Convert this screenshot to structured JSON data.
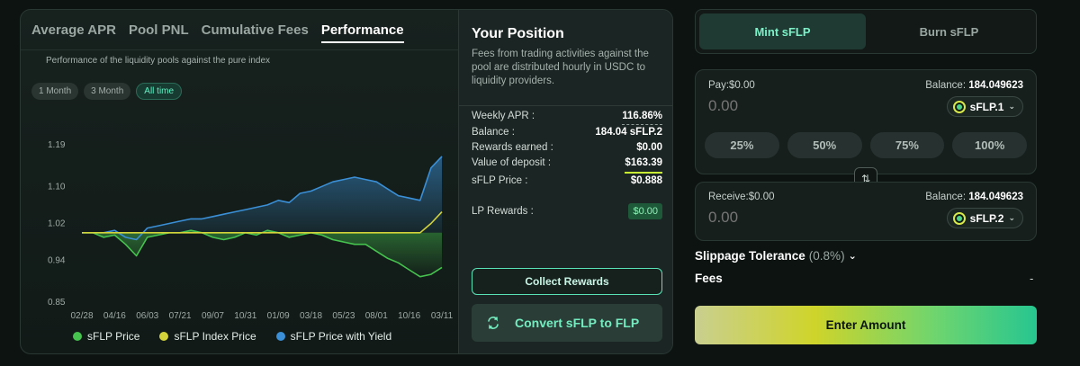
{
  "chart_tabs": [
    "Average APR",
    "Pool PNL",
    "Cumulative Fees",
    "Performance"
  ],
  "active_tab": "Performance",
  "subtitle": "Performance of the liquidity pools against the pure index",
  "range_buttons": [
    "1 Month",
    "3 Month",
    "All time"
  ],
  "active_range": "All time",
  "chart_data": {
    "type": "line",
    "y_ticks": [
      "1.19",
      "1.10",
      "1.02",
      "0.94",
      "0.85"
    ],
    "ylim": [
      0.85,
      1.19
    ],
    "x_ticks": [
      "02/28",
      "04/16",
      "06/03",
      "07/21",
      "09/07",
      "10/31",
      "01/09",
      "03/18",
      "05/23",
      "08/01",
      "10/16",
      "03/11"
    ],
    "grid": false,
    "legend_position": "bottom",
    "series": [
      {
        "name": "sFLP Price",
        "color": "#46c24e",
        "values": [
          1.0,
          1.0,
          0.99,
          0.995,
          0.975,
          0.95,
          0.99,
          0.995,
          1.0,
          1.0,
          1.005,
          1.0,
          0.99,
          0.985,
          0.99,
          1.0,
          0.995,
          1.005,
          1.0,
          0.99,
          0.995,
          1.0,
          0.995,
          0.985,
          0.98,
          0.975,
          0.975,
          0.96,
          0.945,
          0.935,
          0.92,
          0.905,
          0.91,
          0.925
        ]
      },
      {
        "name": "sFLP Index Price",
        "color": "#d4d43a",
        "values": [
          1.0,
          1.0,
          1.0,
          1.0,
          1.0,
          1.0,
          1.0,
          1.0,
          1.0,
          1.0,
          1.0,
          1.0,
          1.0,
          1.0,
          1.0,
          1.0,
          1.0,
          1.0,
          1.0,
          1.0,
          1.0,
          1.0,
          1.0,
          1.0,
          1.0,
          1.0,
          1.0,
          1.0,
          1.0,
          1.0,
          1.0,
          1.0,
          1.02,
          1.045
        ]
      },
      {
        "name": "sFLP Price with Yield",
        "color": "#3a8fd6",
        "values": [
          1.0,
          1.0,
          1.0,
          1.005,
          0.99,
          0.985,
          1.01,
          1.015,
          1.02,
          1.025,
          1.03,
          1.03,
          1.035,
          1.04,
          1.045,
          1.05,
          1.055,
          1.06,
          1.07,
          1.065,
          1.085,
          1.09,
          1.1,
          1.11,
          1.115,
          1.12,
          1.115,
          1.11,
          1.095,
          1.08,
          1.075,
          1.07,
          1.14,
          1.165
        ]
      }
    ]
  },
  "position": {
    "title": "Your Position",
    "description": "Fees from trading activities against the pool are distributed hourly in USDC to liquidity providers.",
    "rows": [
      {
        "label": "Weekly APR :",
        "value": "116.86%"
      },
      {
        "label": "Balance :",
        "value": "184.04 sFLP.2"
      },
      {
        "label": "Rewards earned :",
        "value": "$0.00"
      },
      {
        "label": "Value of deposit :",
        "value": "$163.39"
      },
      {
        "label": "sFLP Price :",
        "value": "$0.888"
      }
    ],
    "lp_rewards_label": "LP Rewards :",
    "lp_rewards_value": "$0.00",
    "collect_label": "Collect Rewards",
    "convert_label": "Convert sFLP to FLP"
  },
  "mint_tabs": [
    "Mint sFLP",
    "Burn sFLP"
  ],
  "active_mint_tab": "Mint sFLP",
  "pay": {
    "label": "Pay:$0.00",
    "balance_label": "Balance:",
    "balance_value": "184.049623",
    "amount_placeholder": "0.00",
    "token": "sFLP.1",
    "percent_buttons": [
      "25%",
      "50%",
      "75%",
      "100%"
    ]
  },
  "receive": {
    "label": "Receive:$0.00",
    "balance_label": "Balance:",
    "balance_value": "184.049623",
    "amount_placeholder": "0.00",
    "token": "sFLP.2"
  },
  "slippage_label": "Slippage Tolerance",
  "slippage_value": "(0.8%)",
  "fees_label": "Fees",
  "fees_value": "-",
  "enter_label": "Enter Amount"
}
